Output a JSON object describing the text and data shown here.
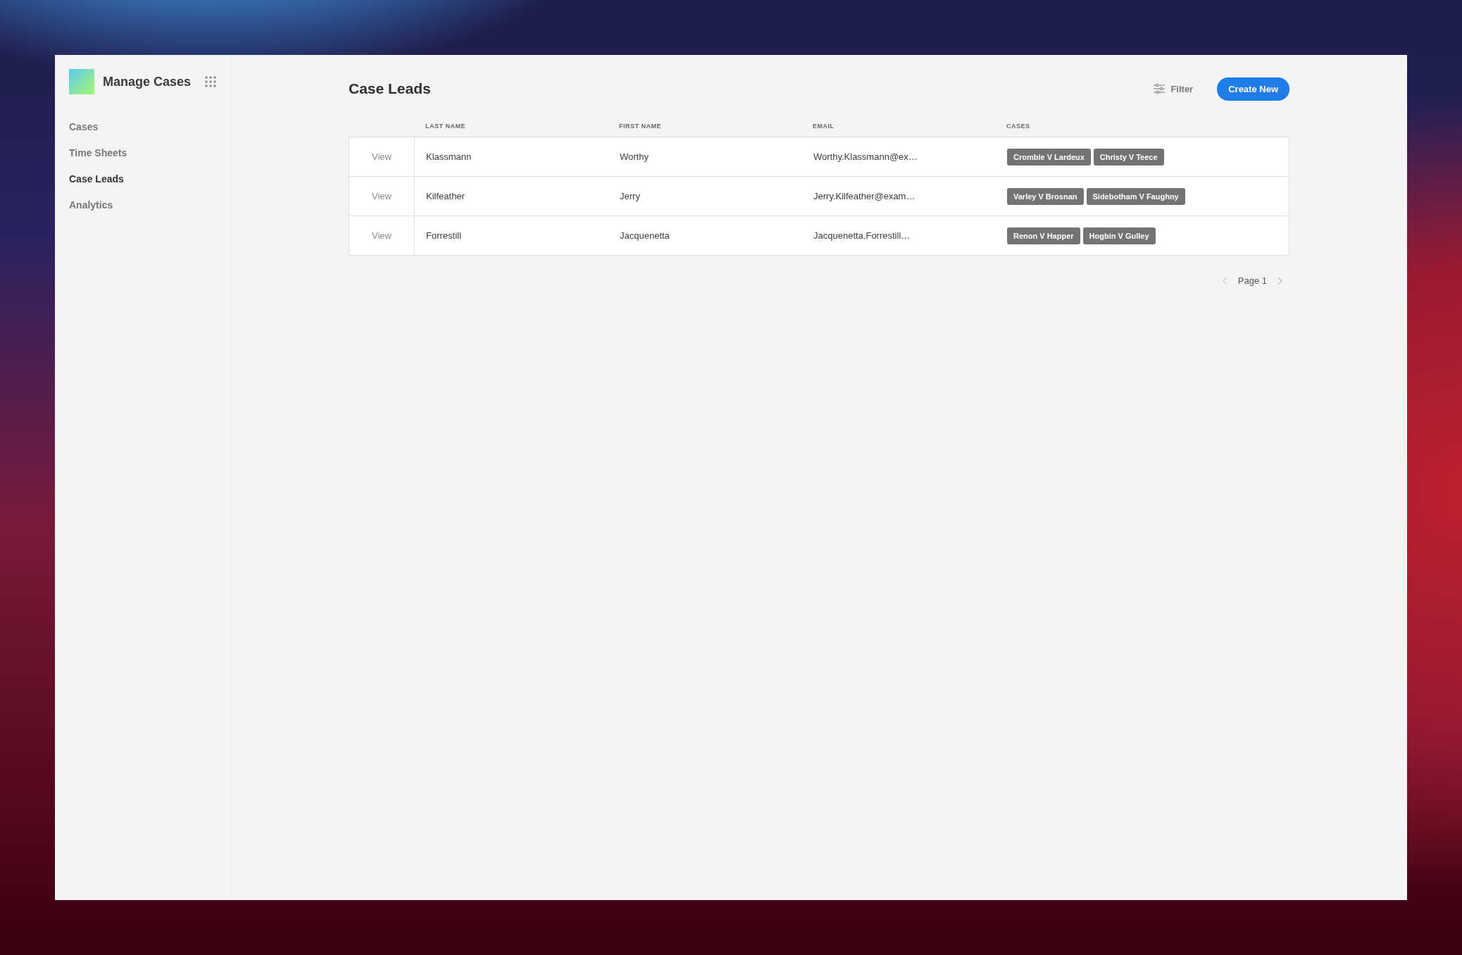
{
  "app": {
    "title": "Manage Cases"
  },
  "sidebar": {
    "items": [
      {
        "label": "Cases",
        "selected": false
      },
      {
        "label": "Time Sheets",
        "selected": false
      },
      {
        "label": "Case Leads",
        "selected": true
      },
      {
        "label": "Analytics",
        "selected": false
      }
    ]
  },
  "page": {
    "title": "Case Leads",
    "filter_label": "Filter",
    "create_label": "Create New"
  },
  "table": {
    "columns": [
      "LAST NAME",
      "FIRST NAME",
      "EMAIL",
      "CASES"
    ],
    "rows": [
      {
        "action": "View",
        "last_name": "Klassmann",
        "first_name": "Worthy",
        "email": "Worthy.Klassmann@ex…",
        "cases": [
          "Crombie V Lardeux",
          "Christy V Teece"
        ]
      },
      {
        "action": "View",
        "last_name": "Kilfeather",
        "first_name": "Jerry",
        "email": "Jerry.Kilfeather@exam…",
        "cases": [
          "Varley V Brosnan",
          "Sidebotham V Faughny"
        ]
      },
      {
        "action": "View",
        "last_name": "Forrestill",
        "first_name": "Jacquenetta",
        "email": "Jacquenetta.Forrestill…",
        "cases": [
          "Renon V Happer",
          "Hogbin V Gulley"
        ]
      }
    ]
  },
  "pagination": {
    "label": "Page 1"
  }
}
